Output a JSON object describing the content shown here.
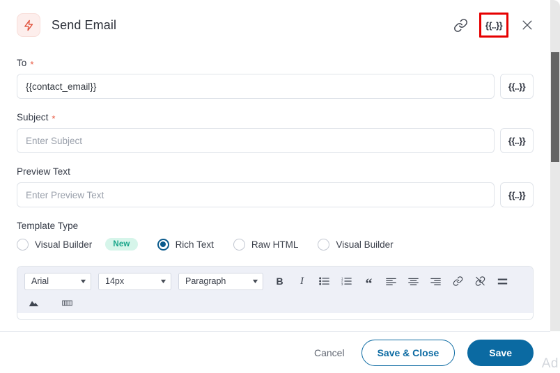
{
  "header": {
    "title": "Send Email",
    "bolt_icon": "lightning-bolt-icon",
    "actions": {
      "link_label": "link-icon",
      "merge_tag_label": "{{..}}",
      "close_label": "close-icon"
    }
  },
  "fields": {
    "to": {
      "label": "To",
      "required_mark": "*",
      "value": "{{contact_email}}",
      "placeholder": "",
      "tag_button": "{{..}}"
    },
    "subject": {
      "label": "Subject",
      "required_mark": "*",
      "value": "",
      "placeholder": "Enter Subject",
      "tag_button": "{{..}}"
    },
    "preview_text": {
      "label": "Preview Text",
      "required_mark": "",
      "value": "",
      "placeholder": "Enter Preview Text",
      "tag_button": "{{..}}"
    }
  },
  "template_type": {
    "label": "Template Type",
    "options": [
      {
        "label": "Visual Builder",
        "selected": false,
        "badge": "New"
      },
      {
        "label": "Rich Text",
        "selected": true,
        "badge": ""
      },
      {
        "label": "Raw HTML",
        "selected": false,
        "badge": ""
      },
      {
        "label": "Visual Builder",
        "selected": false,
        "badge": ""
      }
    ]
  },
  "editor": {
    "font_family": "Arial",
    "font_size": "14px",
    "block_format": "Paragraph",
    "caret": "▼",
    "tools": [
      {
        "name": "bold-icon",
        "glyph": "B"
      },
      {
        "name": "italic-icon",
        "glyph": "I"
      },
      {
        "name": "bullet-list-icon",
        "glyph": ""
      },
      {
        "name": "numbered-list-icon",
        "glyph": ""
      },
      {
        "name": "blockquote-icon",
        "glyph": "“"
      },
      {
        "name": "align-left-icon",
        "glyph": ""
      },
      {
        "name": "align-center-icon",
        "glyph": ""
      },
      {
        "name": "align-right-icon",
        "glyph": ""
      },
      {
        "name": "insert-link-icon",
        "glyph": ""
      },
      {
        "name": "unlink-icon",
        "glyph": ""
      },
      {
        "name": "horizontal-rule-icon",
        "glyph": ""
      }
    ],
    "tools_row2": [
      {
        "name": "insert-image-icon",
        "glyph": ""
      },
      {
        "name": "insert-table-icon",
        "glyph": ""
      }
    ]
  },
  "footer": {
    "cancel": "Cancel",
    "save_and_close": "Save & Close",
    "save": "Save"
  },
  "watermark": "Ad",
  "colors": {
    "primary": "#0b6aa2",
    "highlight": "#e60000",
    "required": "#e8573f",
    "badge_bg": "#d6f5ea",
    "badge_text": "#17a589",
    "bolt_bg": "#fdeeec",
    "bolt_fg": "#e0503a"
  }
}
